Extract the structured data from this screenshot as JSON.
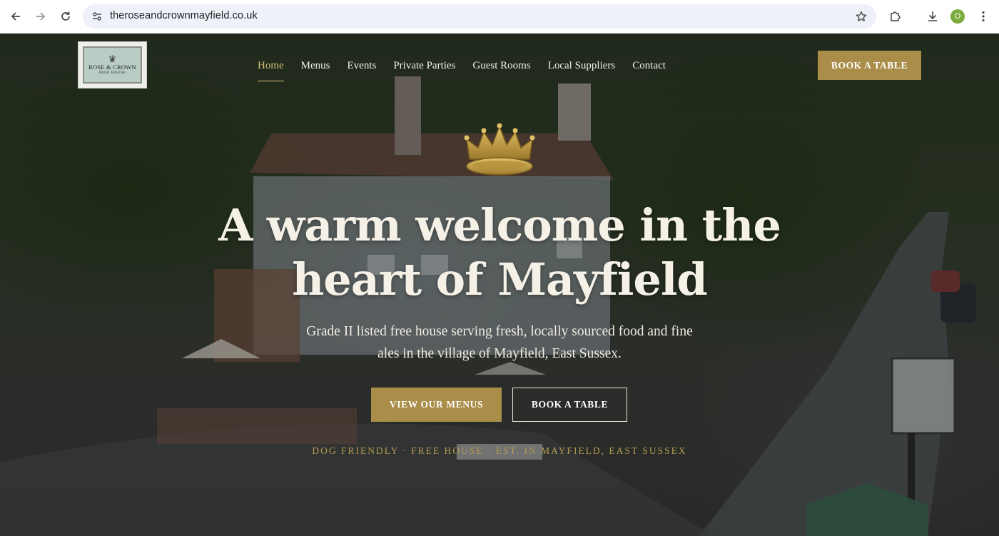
{
  "browser": {
    "url": "theroseandcrownmayfield.co.uk",
    "profile_initial": "O"
  },
  "header": {
    "logo": {
      "name": "ROSE & CROWN",
      "subtitle": "FREE HOUSE"
    },
    "nav": [
      {
        "label": "Home",
        "active": true
      },
      {
        "label": "Menus",
        "active": false
      },
      {
        "label": "Events",
        "active": false
      },
      {
        "label": "Private Parties",
        "active": false
      },
      {
        "label": "Guest Rooms",
        "active": false
      },
      {
        "label": "Local Suppliers",
        "active": false
      },
      {
        "label": "Contact",
        "active": false
      }
    ],
    "book_button": "BOOK A TABLE"
  },
  "hero": {
    "title_line1": "A warm welcome in the",
    "title_line2": "heart of Mayfield",
    "subtitle_line1": "Grade II listed free house serving fresh, locally sourced food and fine",
    "subtitle_line2": "ales in the village of Mayfield, East Sussex.",
    "primary_button": "VIEW OUR MENUS",
    "secondary_button": "BOOK A TABLE",
    "tagline": "DOG FRIENDLY · FREE HOUSE · EST. IN MAYFIELD, EAST SUSSEX"
  },
  "colors": {
    "accent_gold": "#a98d48",
    "active_nav": "#d7bf7a",
    "tagline": "#b79b55"
  },
  "icons": [
    "back-arrow-icon",
    "forward-arrow-icon",
    "reload-icon",
    "site-info-icon",
    "star-icon",
    "extensions-icon",
    "download-icon",
    "more-vert-icon",
    "crown-icon"
  ]
}
